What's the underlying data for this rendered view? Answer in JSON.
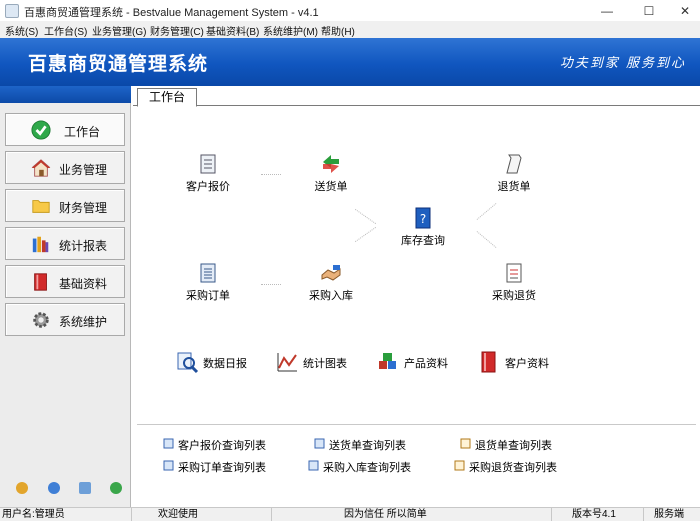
{
  "window": {
    "title": "百惠商贸通管理系统 - Bestvalue Management System - v4.1",
    "minimize": "—",
    "maximize": "☐",
    "close": "✕"
  },
  "menu": [
    "系统(S)",
    "工作台(S)",
    "业务管理(G)",
    "财务管理(C)",
    "基础资料(B)",
    "系统维护(M)",
    "帮助(H)"
  ],
  "banner": {
    "system_name": "百惠商贸通管理系统",
    "slogan": "功夫到家 服务到心"
  },
  "sidebar": {
    "items": [
      {
        "label": "工作台",
        "icon": "check-circle-icon"
      },
      {
        "label": "业务管理",
        "icon": "house-icon"
      },
      {
        "label": "财务管理",
        "icon": "folder-icon"
      },
      {
        "label": "统计报表",
        "icon": "books-icon"
      },
      {
        "label": "基础资料",
        "icon": "red-book-icon"
      },
      {
        "label": "系统维护",
        "icon": "gear-icon"
      }
    ]
  },
  "tabs": [
    "工作台"
  ],
  "workflow": {
    "quote": "客户报价",
    "delivery": "送货单",
    "returns": "退货单",
    "inventory": "库存查询",
    "purchase_order": "采购订单",
    "purchase_in": "采购入库",
    "purchase_return": "采购退货"
  },
  "quick": {
    "daily": "数据日报",
    "chart": "统计图表",
    "product": "产品资料",
    "customer": "客户资料"
  },
  "lists": [
    "客户报价查询列表",
    "送货单查询列表",
    "退货单查询列表",
    "采购订单查询列表",
    "采购入库查询列表",
    "采购退货查询列表"
  ],
  "status": {
    "user": "用户名:管理员",
    "welcome": "欢迎使用",
    "motto": "因为信任 所以简单",
    "version": "版本号4.1",
    "server": "服务端"
  },
  "colors": {
    "banner": "#1056bf",
    "sidebar_bg": "#ececec"
  }
}
